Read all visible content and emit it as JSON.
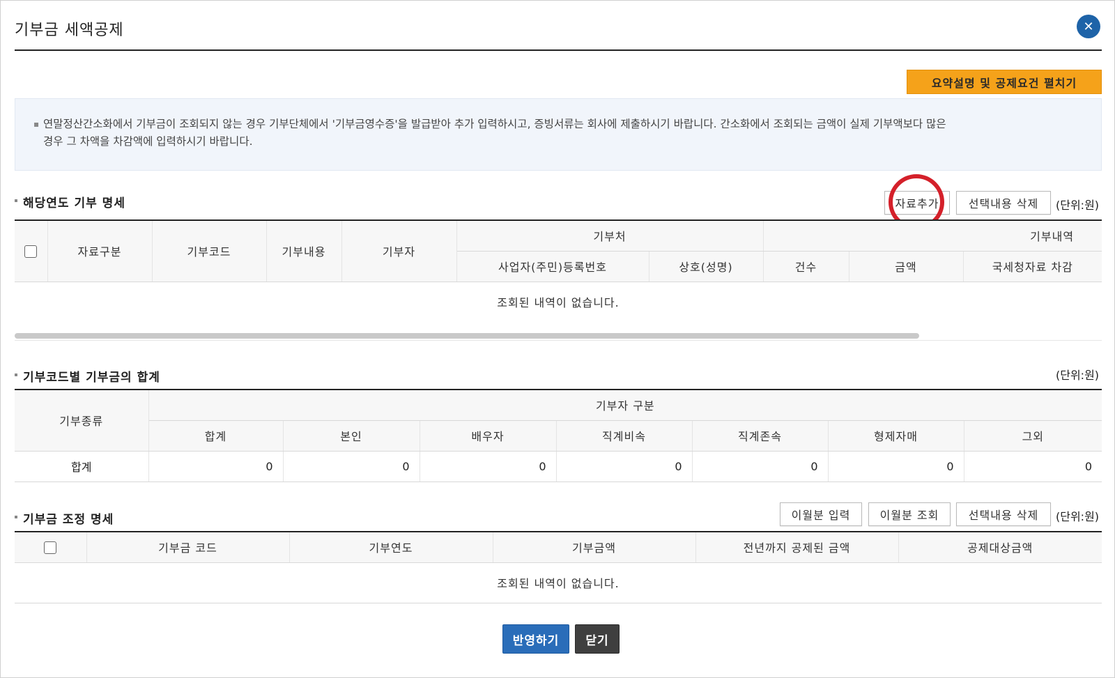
{
  "dialog": {
    "title": "기부금 세액공제",
    "close_icon": "close-icon"
  },
  "summary_button": "요약설명 및 공제요건 펼치기",
  "info": {
    "line1": "연말정산간소화에서 기부금이 조회되지 않는 경우 기부단체에서 '기부금영수증'을 발급받아 추가 입력하시고, 증빙서류는 회사에 제출하시기 바랍니다. 간소화에서 조회되는 금액이 실제 기부액보다 많은",
    "line2": "경우 그 차액을 차감액에 입력하시기 바랍니다."
  },
  "section1": {
    "title": "해당연도 기부 명세",
    "add_button": "자료추가",
    "delete_button": "선택내용 삭제",
    "unit": "(단위:원)",
    "headers": {
      "data_type": "자료구분",
      "code": "기부코드",
      "content": "기부내용",
      "donor": "기부자",
      "recipient": "기부처",
      "reg_no": "사업자(주민)등록번호",
      "name": "상호(성명)",
      "details": "기부내역",
      "count": "건수",
      "amount": "금액",
      "nts_deduct": "국세청자료 차감"
    },
    "empty_message": "조회된 내역이 없습니다."
  },
  "section2": {
    "title": "기부코드별 기부금의 합계",
    "unit": "(단위:원)",
    "headers": {
      "type": "기부종류",
      "donor_group": "기부자 구분",
      "cols": [
        "합계",
        "본인",
        "배우자",
        "직계비속",
        "직계존속",
        "형제자매",
        "그외"
      ]
    },
    "row": {
      "label": "합계",
      "values": [
        "0",
        "0",
        "0",
        "0",
        "0",
        "0",
        "0"
      ]
    }
  },
  "section3": {
    "title": "기부금 조정 명세",
    "carryover_input_button": "이월분 입력",
    "carryover_query_button": "이월분 조회",
    "delete_button": "선택내용 삭제",
    "unit": "(단위:원)",
    "headers": [
      "기부금 코드",
      "기부연도",
      "기부금액",
      "전년까지 공제된 금액",
      "공제대상금액"
    ],
    "empty_message": "조회된 내역이 없습니다."
  },
  "footer": {
    "apply_button": "반영하기",
    "close_button": "닫기"
  },
  "colors": {
    "accent_blue": "#2a6db9",
    "summary_orange": "#f5a21a",
    "highlight_red": "#d4202a",
    "info_bg": "#f1f5fb"
  }
}
